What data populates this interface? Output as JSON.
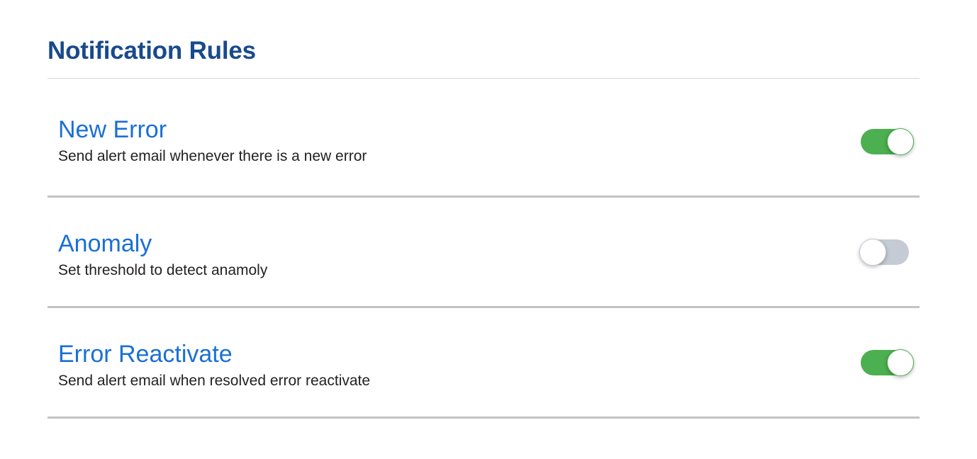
{
  "page": {
    "title": "Notification Rules"
  },
  "colors": {
    "title": "#184a8c",
    "rule_name": "#1a6fd6",
    "toggle_on": "#4caf50",
    "toggle_off": "#c5cbd5"
  },
  "rules": [
    {
      "name": "New Error",
      "description": "Send alert email whenever there is a new error",
      "enabled": true
    },
    {
      "name": "Anomaly",
      "description": "Set threshold to detect anamoly",
      "enabled": false
    },
    {
      "name": "Error Reactivate",
      "description": "Send alert email when resolved error reactivate",
      "enabled": true
    }
  ]
}
